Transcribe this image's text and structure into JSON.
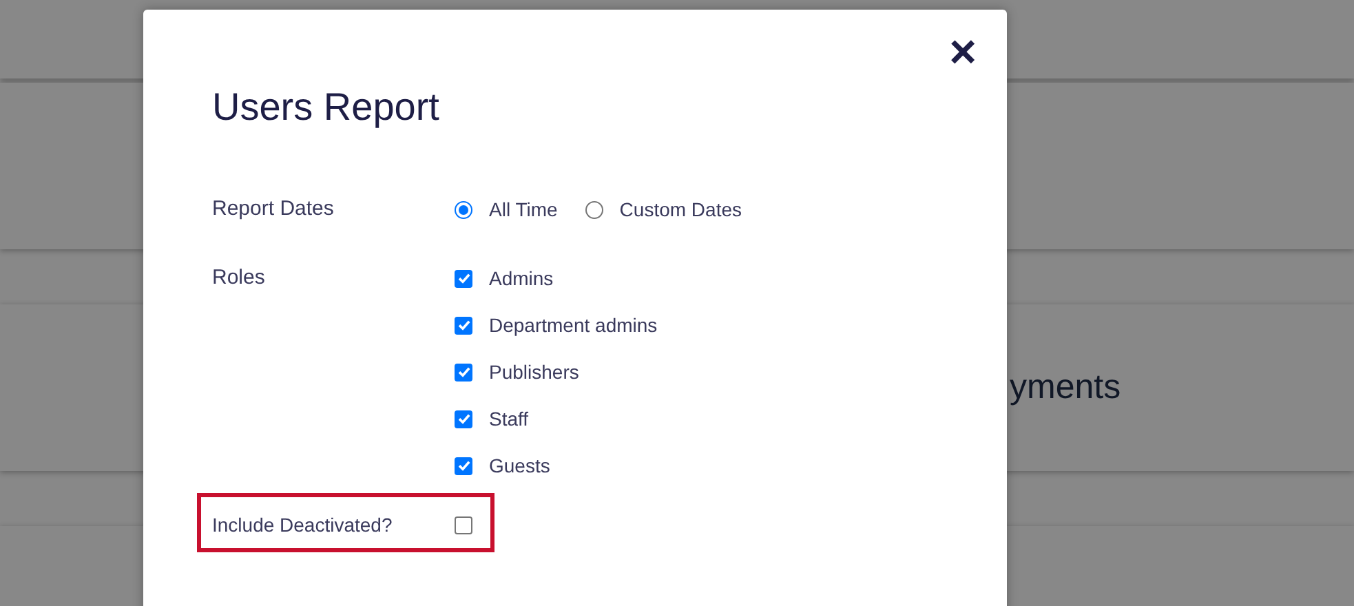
{
  "background": {
    "card_text": "yments"
  },
  "dialog": {
    "title": "Users Report",
    "close": "×",
    "report_dates": {
      "label": "Report Dates",
      "options": [
        {
          "label": "All Time",
          "selected": true
        },
        {
          "label": "Custom Dates",
          "selected": false
        }
      ]
    },
    "roles": {
      "label": "Roles",
      "options": [
        {
          "label": "Admins",
          "checked": true
        },
        {
          "label": "Department admins",
          "checked": true
        },
        {
          "label": "Publishers",
          "checked": true
        },
        {
          "label": "Staff",
          "checked": true
        },
        {
          "label": "Guests",
          "checked": true
        }
      ]
    },
    "include_deactivated": {
      "label": "Include Deactivated?",
      "checked": false,
      "highlighted": true
    }
  }
}
